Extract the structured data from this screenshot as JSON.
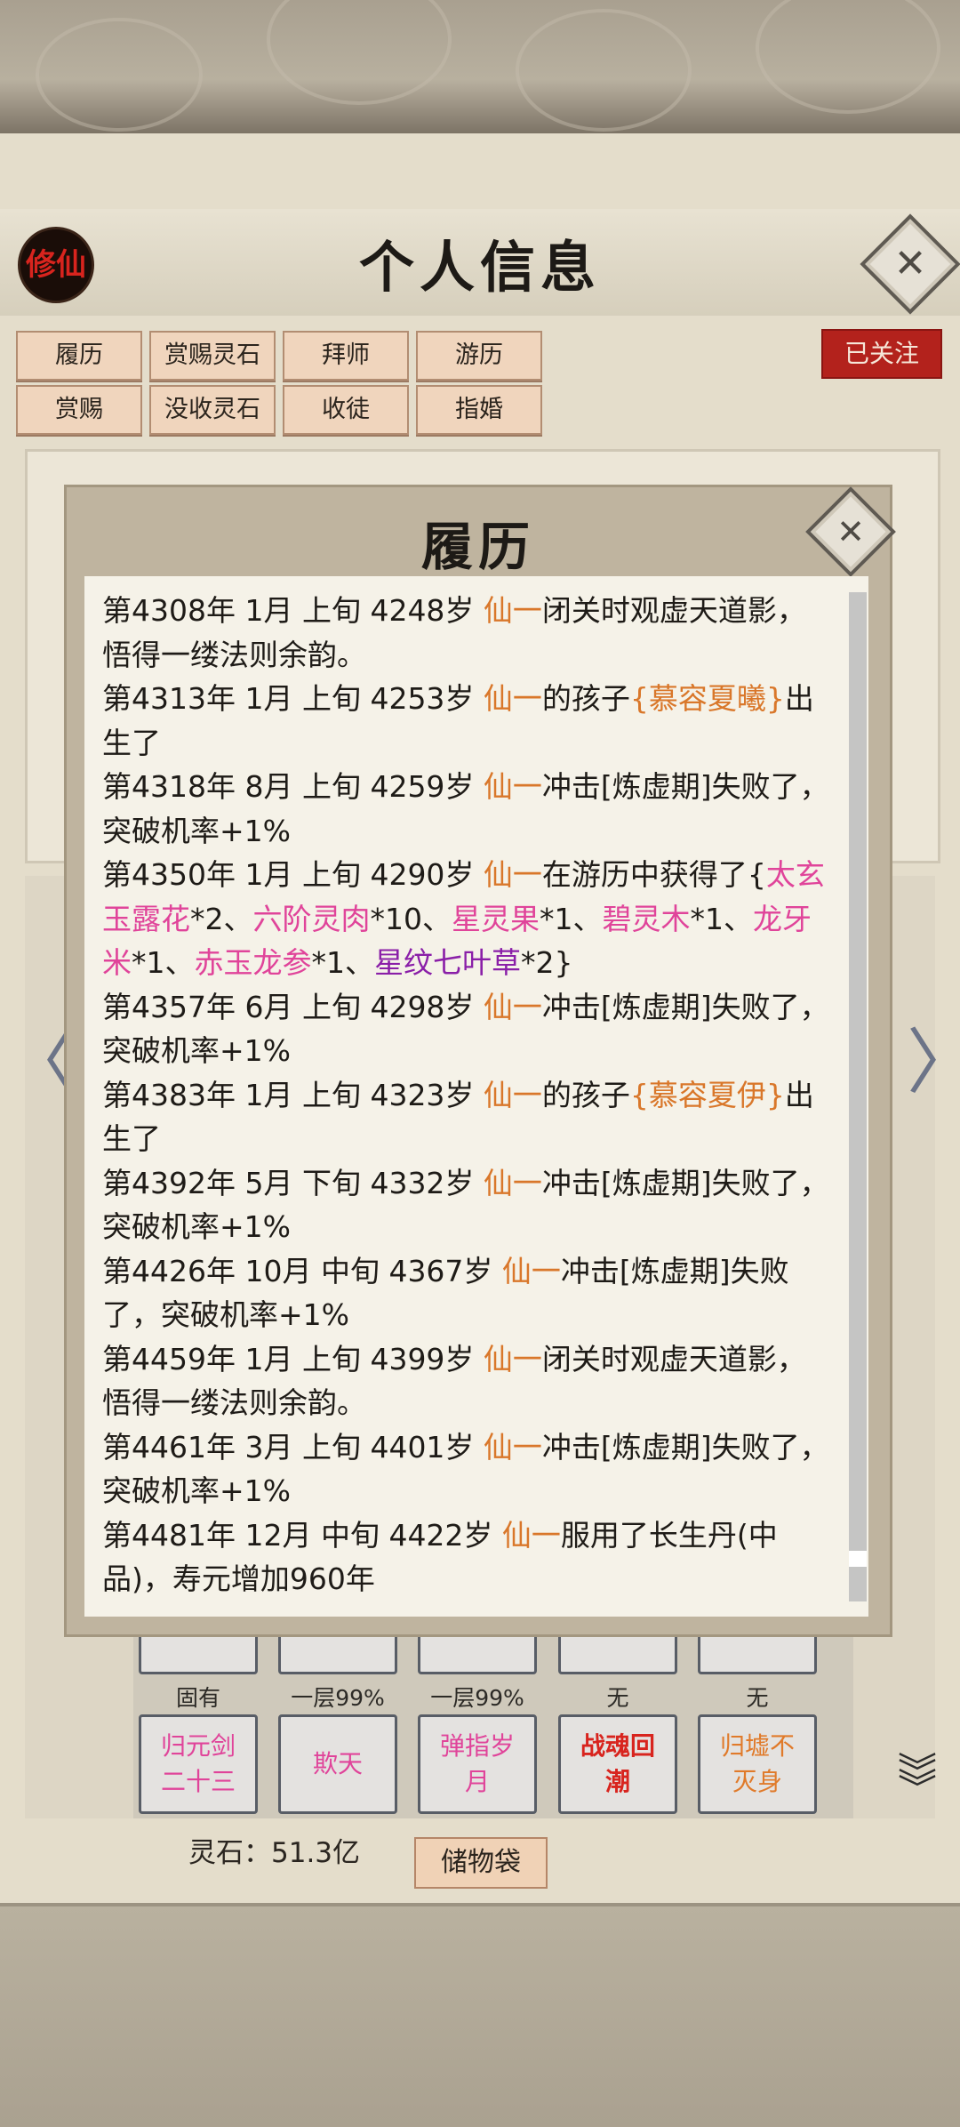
{
  "header": {
    "badge": "修仙",
    "title": "个人信息"
  },
  "tabs": [
    {
      "label": "履历"
    },
    {
      "label": "赏赐灵石"
    },
    {
      "label": "拜师"
    },
    {
      "label": "游历"
    },
    {
      "label": "赏赐"
    },
    {
      "label": "没收灵石"
    },
    {
      "label": "收徒"
    },
    {
      "label": "指婚"
    }
  ],
  "follow_label": "已关注",
  "skills": {
    "top_levels": [
      "固有",
      "一层99%",
      "一层99%",
      "无",
      "无"
    ],
    "bottom": [
      {
        "name": "归元剑二十三",
        "color": "#e0449a"
      },
      {
        "name": "欺天",
        "color": "#e0449a"
      },
      {
        "name": "弹指岁月",
        "color": "#e0449a"
      },
      {
        "name": "战魂回潮",
        "color": "#d8241e"
      },
      {
        "name": "归墟不灭身",
        "color": "#e07a2a"
      }
    ]
  },
  "footer": {
    "spirit_stone": "灵石：51.3亿",
    "bag_label": "储物袋"
  },
  "modal": {
    "title": "履历",
    "entries": [
      [
        {
          "t": "第4308年 1月 上旬 4248岁 "
        },
        {
          "t": "仙一",
          "c": "o"
        },
        {
          "t": "闭关时观虚天道影，悟得一缕法则余韵。"
        }
      ],
      [
        {
          "t": "第4313年 1月 上旬 4253岁 "
        },
        {
          "t": "仙一",
          "c": "o"
        },
        {
          "t": "的孩子"
        },
        {
          "t": "{慕容夏曦}",
          "c": "o"
        },
        {
          "t": "出生了"
        }
      ],
      [
        {
          "t": "第4318年 8月 上旬 4259岁 "
        },
        {
          "t": "仙一",
          "c": "o"
        },
        {
          "t": "冲击[炼虚期]失败了，突破机率+1%"
        }
      ],
      [
        {
          "t": "第4350年 1月 上旬 4290岁 "
        },
        {
          "t": "仙一",
          "c": "o"
        },
        {
          "t": "在游历中获得了{"
        },
        {
          "t": "太玄玉露花",
          "c": "p"
        },
        {
          "t": "*2、"
        },
        {
          "t": "六阶灵肉",
          "c": "p"
        },
        {
          "t": "*10、"
        },
        {
          "t": "星灵果",
          "c": "p"
        },
        {
          "t": "*1、"
        },
        {
          "t": "碧灵木",
          "c": "p"
        },
        {
          "t": "*1、"
        },
        {
          "t": "龙牙米",
          "c": "p"
        },
        {
          "t": "*1、"
        },
        {
          "t": "赤玉龙参",
          "c": "p"
        },
        {
          "t": "*1、"
        },
        {
          "t": "星纹七叶草",
          "c": "v"
        },
        {
          "t": "*2}"
        }
      ],
      [
        {
          "t": "第4357年 6月 上旬 4298岁 "
        },
        {
          "t": "仙一",
          "c": "o"
        },
        {
          "t": "冲击[炼虚期]失败了，突破机率+1%"
        }
      ],
      [
        {
          "t": "第4383年 1月 上旬 4323岁 "
        },
        {
          "t": "仙一",
          "c": "o"
        },
        {
          "t": "的孩子"
        },
        {
          "t": "{慕容夏伊}",
          "c": "o"
        },
        {
          "t": "出生了"
        }
      ],
      [
        {
          "t": "第4392年 5月 下旬 4332岁 "
        },
        {
          "t": "仙一",
          "c": "o"
        },
        {
          "t": "冲击[炼虚期]失败了，突破机率+1%"
        }
      ],
      [
        {
          "t": "第4426年 10月 中旬  4367岁  "
        },
        {
          "t": "仙一",
          "c": "o"
        },
        {
          "t": "冲击[炼虚期]失败了，突破机率+1%"
        }
      ],
      [
        {
          "t": "第4459年 1月 上旬 4399岁 "
        },
        {
          "t": "仙一",
          "c": "o"
        },
        {
          "t": "闭关时观虚天道影，悟得一缕法则余韵。"
        }
      ],
      [
        {
          "t": "第4461年 3月 上旬 4401岁 "
        },
        {
          "t": "仙一",
          "c": "o"
        },
        {
          "t": "冲击[炼虚期]失败了，突破机率+1%"
        }
      ],
      [
        {
          "t": "第4481年 12月 中旬  4422岁  "
        },
        {
          "t": "仙一",
          "c": "o"
        },
        {
          "t": "服用了长生丹(中品)，寿元增加960年"
        }
      ]
    ]
  }
}
